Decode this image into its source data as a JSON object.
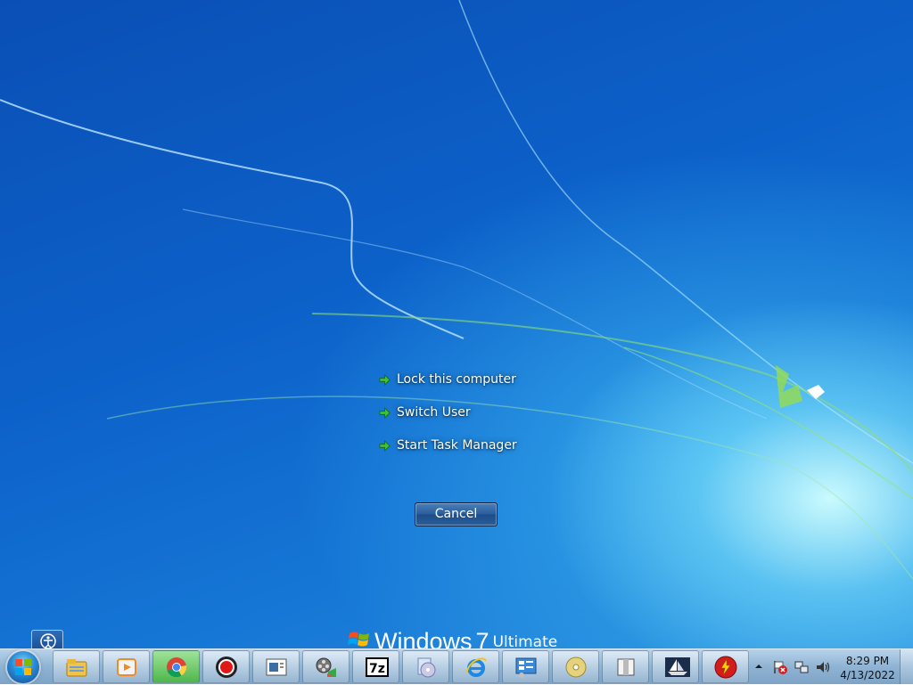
{
  "security_menu": {
    "items": [
      {
        "label": "Lock this computer"
      },
      {
        "label": "Switch User"
      },
      {
        "label": "Start Task Manager"
      }
    ],
    "cancel_label": "Cancel"
  },
  "branding": {
    "product": "Windows",
    "version": "7",
    "edition": "Ultimate"
  },
  "taskbar": {
    "start_icon": "windows-start-orb",
    "pinned": [
      "file-explorer-icon",
      "media-player-icon",
      "chrome-icon",
      "screen-recorder-icon",
      "window-app-icon",
      "video-editor-icon",
      "7zip-icon",
      "disc-burner-icon",
      "internet-explorer-icon",
      "control-panel-icon",
      "dvd-icon",
      "archive-box-icon",
      "ship-app-icon",
      "flash-app-icon"
    ],
    "seven_zip_label": "7z",
    "clock_time": "8:29 PM",
    "clock_date": "4/13/2022"
  },
  "colors": {
    "accent": "#1c4d8a",
    "arrow_green": "#3ec23a"
  }
}
